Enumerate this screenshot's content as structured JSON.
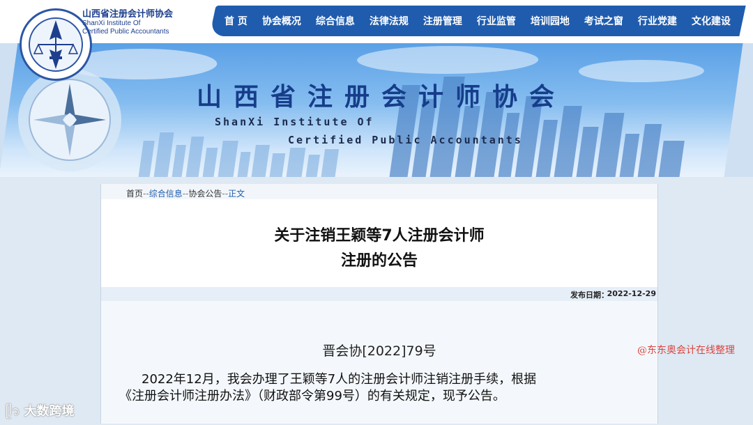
{
  "header": {
    "brand_cn": "山西省注册会计师协会",
    "brand_en1": "ShanXi Institute Of",
    "brand_en2": "Certified Public Accountants",
    "logo_ring_text": "INSTITUTE OF CERTIFIED PUBLIC ACCOUNTANTS",
    "logo_bottom_text": "山西省注册会计师协会"
  },
  "nav": {
    "items": [
      "首 页",
      "协会概况",
      "综合信息",
      "法律法规",
      "注册管理",
      "行业监管",
      "培训园地",
      "考试之窗",
      "行业党建",
      "文化建设"
    ]
  },
  "banner": {
    "title": "山西省注册会计师协会",
    "en1": "ShanXi Institute Of",
    "en2": "Certified Public Accountants"
  },
  "breadcrumb": {
    "home": "首页",
    "sep": "--",
    "level1": "综合信息",
    "level2": "协会公告",
    "current": "正文"
  },
  "article": {
    "title_line1": "关于注销王颖等7人注册会计师",
    "title_line2": "注册的公告",
    "date_label": "发布日期：",
    "date_value": "2022-12-29",
    "doc_number": "晋会协[2022]79号",
    "para_line1": "2022年12月，我会办理了王颖等7人的注册会计师注销注册手续，根据",
    "para_line2": "《注册会计师注册办法》（财政部令第99号）的有关规定，现予公告。"
  },
  "watermarks": {
    "right": "@东东奥会计在线整理",
    "left": "大数跨境"
  },
  "colors": {
    "nav_blue": "#1f5cae",
    "brand_blue": "#1d3f8e",
    "watermark_red": "#d9453f"
  }
}
